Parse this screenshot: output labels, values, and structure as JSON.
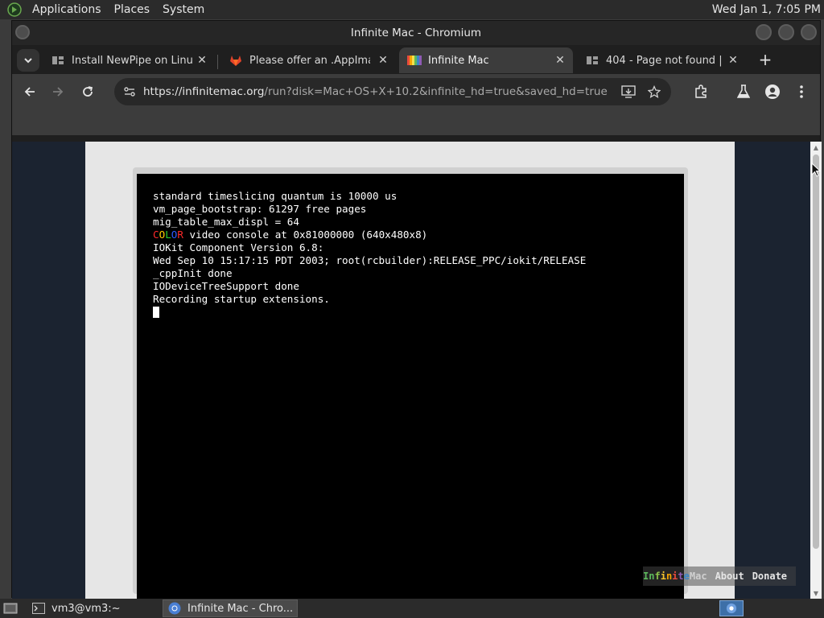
{
  "top_panel": {
    "menus": [
      "Applications",
      "Places",
      "System"
    ],
    "clock": "Wed Jan  1,  7:05 PM"
  },
  "window": {
    "title": "Infinite Mac - Chromium"
  },
  "tabs": [
    {
      "title": "Install NewPipe on Linux |",
      "icon": "document-favicon-icon",
      "active": false
    },
    {
      "title": "Please offer an .AppImage",
      "icon": "gitlab-favicon-icon",
      "active": false
    },
    {
      "title": "Infinite Mac",
      "icon": "infinite-mac-favicon-icon",
      "active": true
    },
    {
      "title": "404 - Page not found | Fla",
      "icon": "document-favicon-icon",
      "active": false
    }
  ],
  "toolbar": {
    "url_host": "https://infinitemac.org",
    "url_path": "/run?disk=Mac+OS+X+10.2&infinite_hd=true&saved_hd=true"
  },
  "console": {
    "lines": [
      "standard timeslicing quantum is 10000 us",
      "vm_page_bootstrap: 61297 free pages",
      "mig_table_max_displ = 64",
      " video console at 0x81000000 (640x480x8)",
      "IOKit Component Version 6.8:",
      "Wed Sep 10 15:17:15 PDT 2003; root(rcbuilder):RELEASE_PPC/iokit/RELEASE",
      "_cppInit done",
      "IODeviceTreeSupport done",
      "Recording startup extensions."
    ],
    "color_word": "COLOR"
  },
  "overlay": {
    "logo_first": "Infinite",
    "logo_second": "Mac",
    "about": "About",
    "donate": "Donate"
  },
  "taskbar": {
    "items": [
      {
        "label": "vm3@vm3:~",
        "icon": "terminal-icon"
      },
      {
        "label": "Infinite Mac - Chro...",
        "icon": "chromium-icon"
      }
    ]
  }
}
